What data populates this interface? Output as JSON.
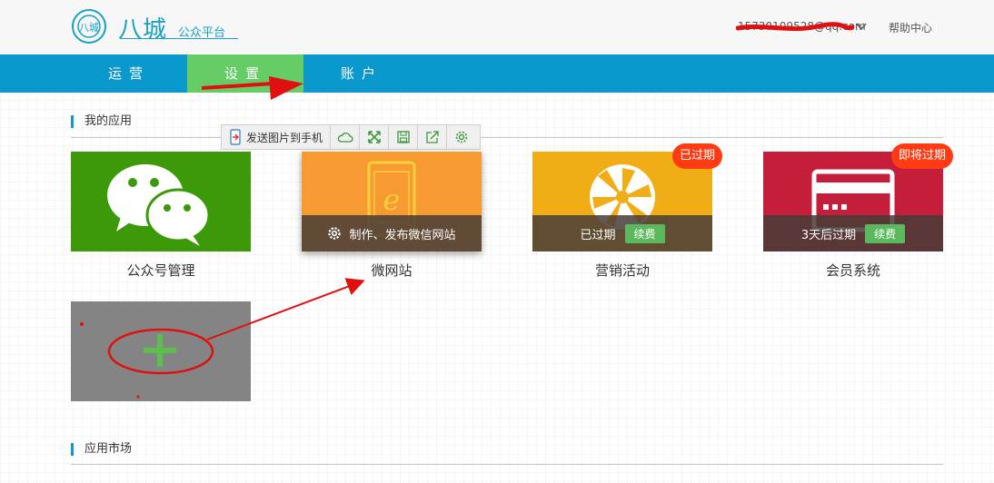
{
  "header": {
    "logo_text": "八城",
    "brand": "八城",
    "platform": "公众平台",
    "account_email": "15730109528@qq.com",
    "help_label": "帮助中心"
  },
  "nav": {
    "items": [
      {
        "label": "运营"
      },
      {
        "label": "设置"
      },
      {
        "label": "账户"
      }
    ]
  },
  "toolbar": {
    "send_label": "发送图片到手机",
    "icons": [
      "cloud-icon",
      "expand-icon",
      "save-icon",
      "share-icon",
      "settings-icon"
    ]
  },
  "my_apps": {
    "title": "我的应用",
    "apps": [
      {
        "name": "公众号管理",
        "icon": "wechat-icon",
        "color": "#3c9a09"
      },
      {
        "name": "微网站",
        "icon": "phone-ie-icon",
        "color": "#f89a32",
        "hover_action": "制作、发布微信网站"
      },
      {
        "name": "营销活动",
        "icon": "wheel-icon",
        "color": "#f0ad15",
        "badge": "已过期",
        "status": "已过期",
        "renew": "续费"
      },
      {
        "name": "会员系统",
        "icon": "card-icon",
        "color": "#c41e3a",
        "badge": "即将过期",
        "status": "3天后过期",
        "renew": "续费"
      }
    ],
    "add_icon": "plus-icon"
  },
  "market": {
    "title": "应用市场"
  },
  "colors": {
    "nav_bg": "#0b98cc",
    "nav_active": "#66cc66",
    "badge": "#ff3b14",
    "renew": "#5cb85c"
  }
}
